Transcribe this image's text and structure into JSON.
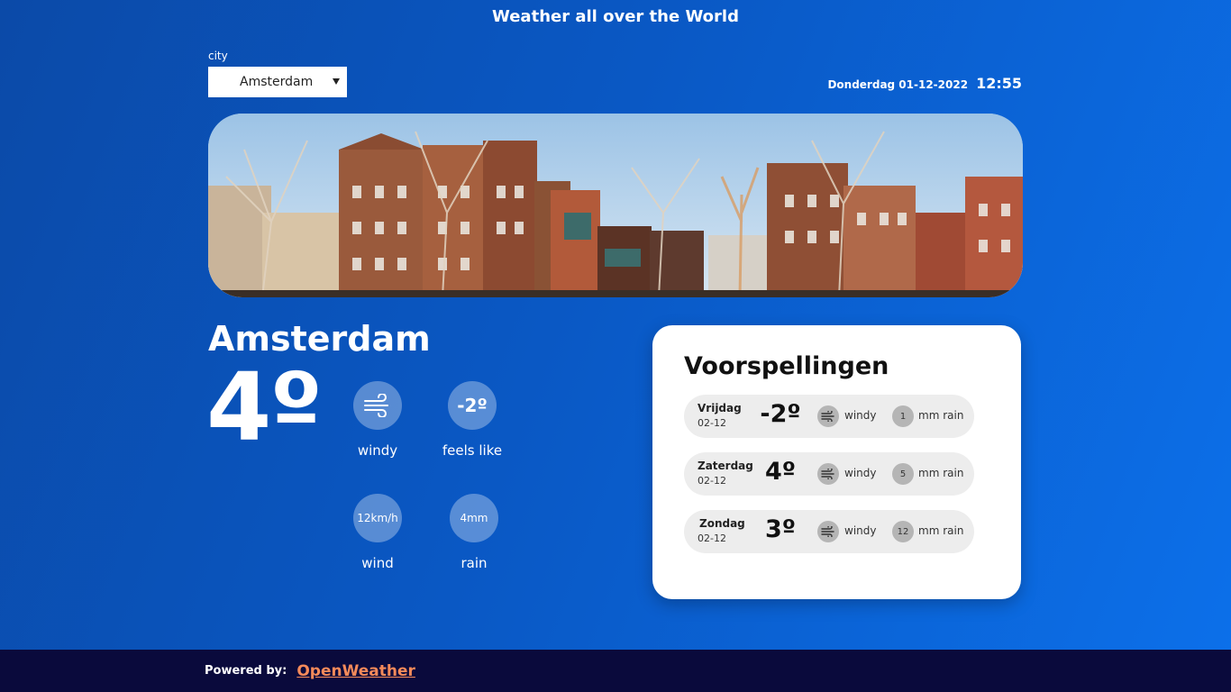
{
  "header": {
    "title": "Weather all over the World"
  },
  "city_picker": {
    "label": "city",
    "selected": "Amsterdam"
  },
  "datetime": {
    "date": "Donderdag 01-12-2022",
    "time": "12:55"
  },
  "current": {
    "city": "Amsterdam",
    "temperature": "4º",
    "stats": [
      {
        "value": "",
        "icon": "wind-icon",
        "label": "windy"
      },
      {
        "value": "-2º",
        "label": "feels like"
      },
      {
        "value": "12km/h",
        "label": "wind"
      },
      {
        "value": "4mm",
        "label": "rain"
      }
    ]
  },
  "forecast": {
    "title": "Voorspellingen",
    "items": [
      {
        "day": "Vrijdag",
        "date": "02-12",
        "temp": "-2º",
        "wind_label": "windy",
        "rain": "1",
        "rain_label": "mm rain"
      },
      {
        "day": "Zaterdag",
        "date": "02-12",
        "temp": "4º",
        "wind_label": "windy",
        "rain": "5",
        "rain_label": "mm rain"
      },
      {
        "day": "Zondag",
        "date": "02-12",
        "temp": "3º",
        "wind_label": "windy",
        "rain": "12",
        "rain_label": "mm rain"
      }
    ]
  },
  "footer": {
    "powered_by": "Powered by:",
    "link_text": "OpenWeather",
    "link_color": "#f58a5a"
  },
  "colors": {
    "bg_start": "#0b4aa8",
    "bg_end": "#0c70ea",
    "footer_bg": "#0a0a3c",
    "card_bg": "#ffffff"
  }
}
